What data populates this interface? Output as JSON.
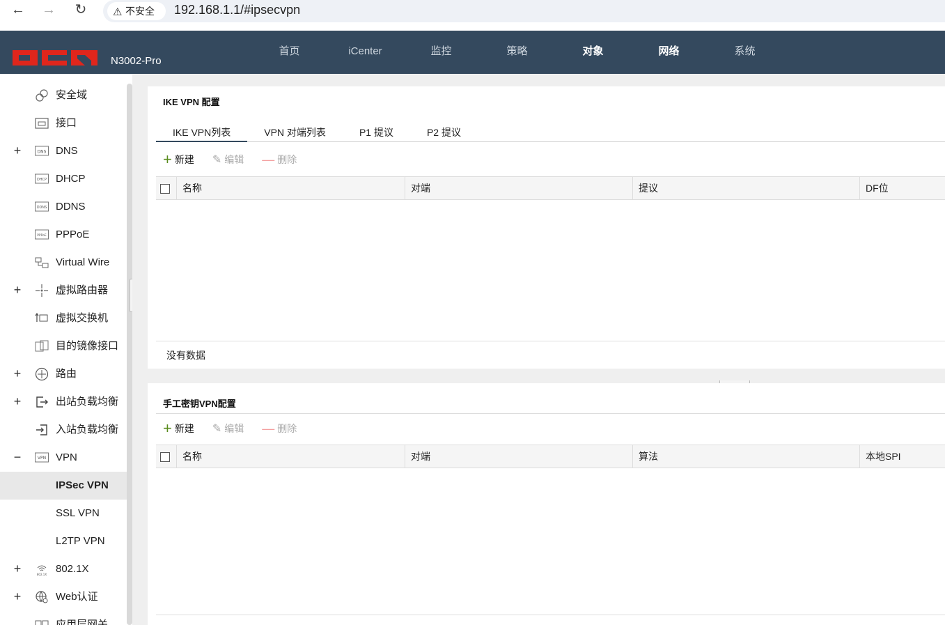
{
  "browser": {
    "back": "←",
    "forward": "→",
    "reload": "↻",
    "security_label": "不安全",
    "url": "192.168.1.1/#ipsecvpn"
  },
  "header": {
    "brand": "DCN",
    "model": "N3002-Pro",
    "nav": [
      "首页",
      "iCenter",
      "监控",
      "策略",
      "对象",
      "网络",
      "系统"
    ],
    "accent_color": "#34495e",
    "brand_color": "#e0261c"
  },
  "sidebar": {
    "items": [
      {
        "label": "安全域",
        "icon": "security-zone-icon",
        "expand": ""
      },
      {
        "label": "接口",
        "icon": "interface-icon",
        "expand": ""
      },
      {
        "label": "DNS",
        "icon": "dns-icon",
        "expand": "+"
      },
      {
        "label": "DHCP",
        "icon": "dhcp-icon",
        "expand": ""
      },
      {
        "label": "DDNS",
        "icon": "ddns-icon",
        "expand": ""
      },
      {
        "label": "PPPoE",
        "icon": "pppoe-icon",
        "expand": ""
      },
      {
        "label": "Virtual Wire",
        "icon": "virtual-wire-icon",
        "expand": ""
      },
      {
        "label": "虚拟路由器",
        "icon": "virtual-router-icon",
        "expand": "+"
      },
      {
        "label": "虚拟交换机",
        "icon": "virtual-switch-icon",
        "expand": ""
      },
      {
        "label": "目的镜像接口",
        "icon": "mirror-interface-icon",
        "expand": ""
      },
      {
        "label": "路由",
        "icon": "route-icon",
        "expand": "+"
      },
      {
        "label": "出站负载均衡",
        "icon": "outbound-lb-icon",
        "expand": "+"
      },
      {
        "label": "入站负载均衡",
        "icon": "inbound-lb-icon",
        "expand": ""
      },
      {
        "label": "VPN",
        "icon": "vpn-icon",
        "expand": "−"
      },
      {
        "label": "IPSec VPN",
        "icon": "",
        "expand": ""
      },
      {
        "label": "SSL VPN",
        "icon": "",
        "expand": ""
      },
      {
        "label": "L2TP VPN",
        "icon": "",
        "expand": ""
      },
      {
        "label": "802.1X",
        "icon": "8021x-icon",
        "expand": "+"
      },
      {
        "label": "Web认证",
        "icon": "web-auth-icon",
        "expand": "+"
      },
      {
        "label": "应用层网关",
        "icon": "alg-icon",
        "expand": ""
      }
    ],
    "active": "IPSec VPN"
  },
  "ike_panel": {
    "title": "IKE VPN 配置",
    "tabs": [
      "IKE VPN列表",
      "VPN 对端列表",
      "P1 提议",
      "P2 提议"
    ],
    "toolbar": {
      "add": "新建",
      "edit": "编辑",
      "delete": "删除"
    },
    "columns": [
      "名称",
      "对端",
      "提议",
      "DF位"
    ],
    "empty_text": "没有数据"
  },
  "manual_panel": {
    "title": "手工密钥VPN配置",
    "toolbar": {
      "add": "新建",
      "edit": "编辑",
      "delete": "删除"
    },
    "columns": [
      "名称",
      "对端",
      "算法",
      "本地SPI"
    ]
  }
}
